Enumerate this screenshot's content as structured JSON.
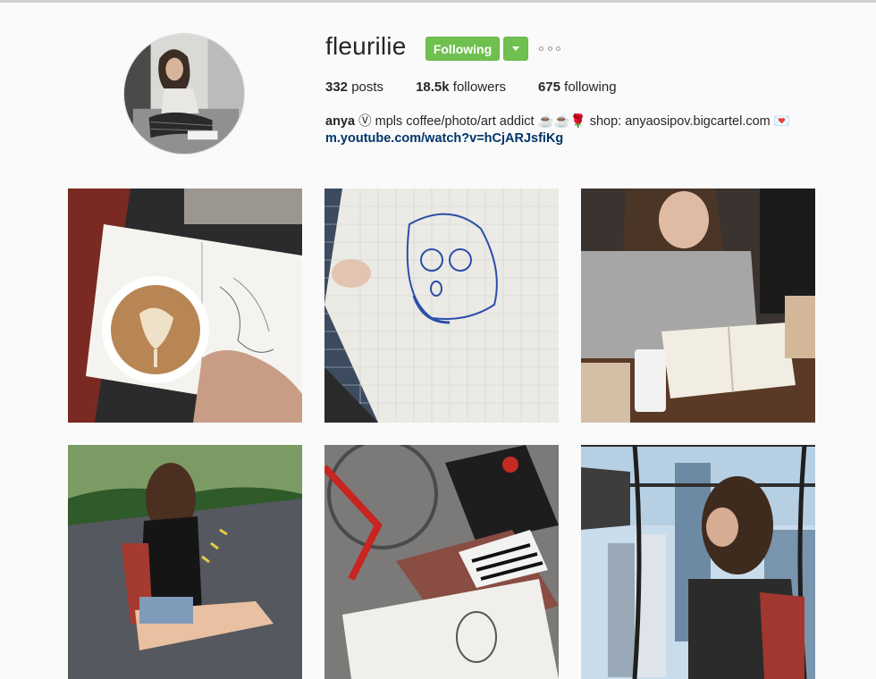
{
  "profile": {
    "username": "fleurilie",
    "follow_button_label": "Following",
    "dropdown_icon": "caret-down-icon",
    "more_icon": "more-options-icon",
    "stats": {
      "posts_count": "332",
      "posts_label": " posts",
      "followers_count": "18.5k",
      "followers_label": " followers",
      "following_count": "675",
      "following_label": " following"
    },
    "bio": {
      "name": "anya",
      "text": " Ⓥ mpls coffee/photo/art addict ☕☕🌹 shop: anyaosipov.bigcartel.com 💌",
      "link": "m.youtube.com/watch?v=hCjARJsfiKg"
    }
  },
  "colors": {
    "follow_green": "#70c050",
    "link_blue": "#003569",
    "background": "#fafafa"
  },
  "posts": [
    {
      "subject": "latte-art-and-sketchbook"
    },
    {
      "subject": "blue-pen-portrait-sketch"
    },
    {
      "subject": "woman-reading-with-coffee"
    },
    {
      "subject": "woman-sitting-in-park-road"
    },
    {
      "subject": "bike-backpack-and-sketchbook"
    },
    {
      "subject": "woman-on-city-observation-deck"
    }
  ]
}
